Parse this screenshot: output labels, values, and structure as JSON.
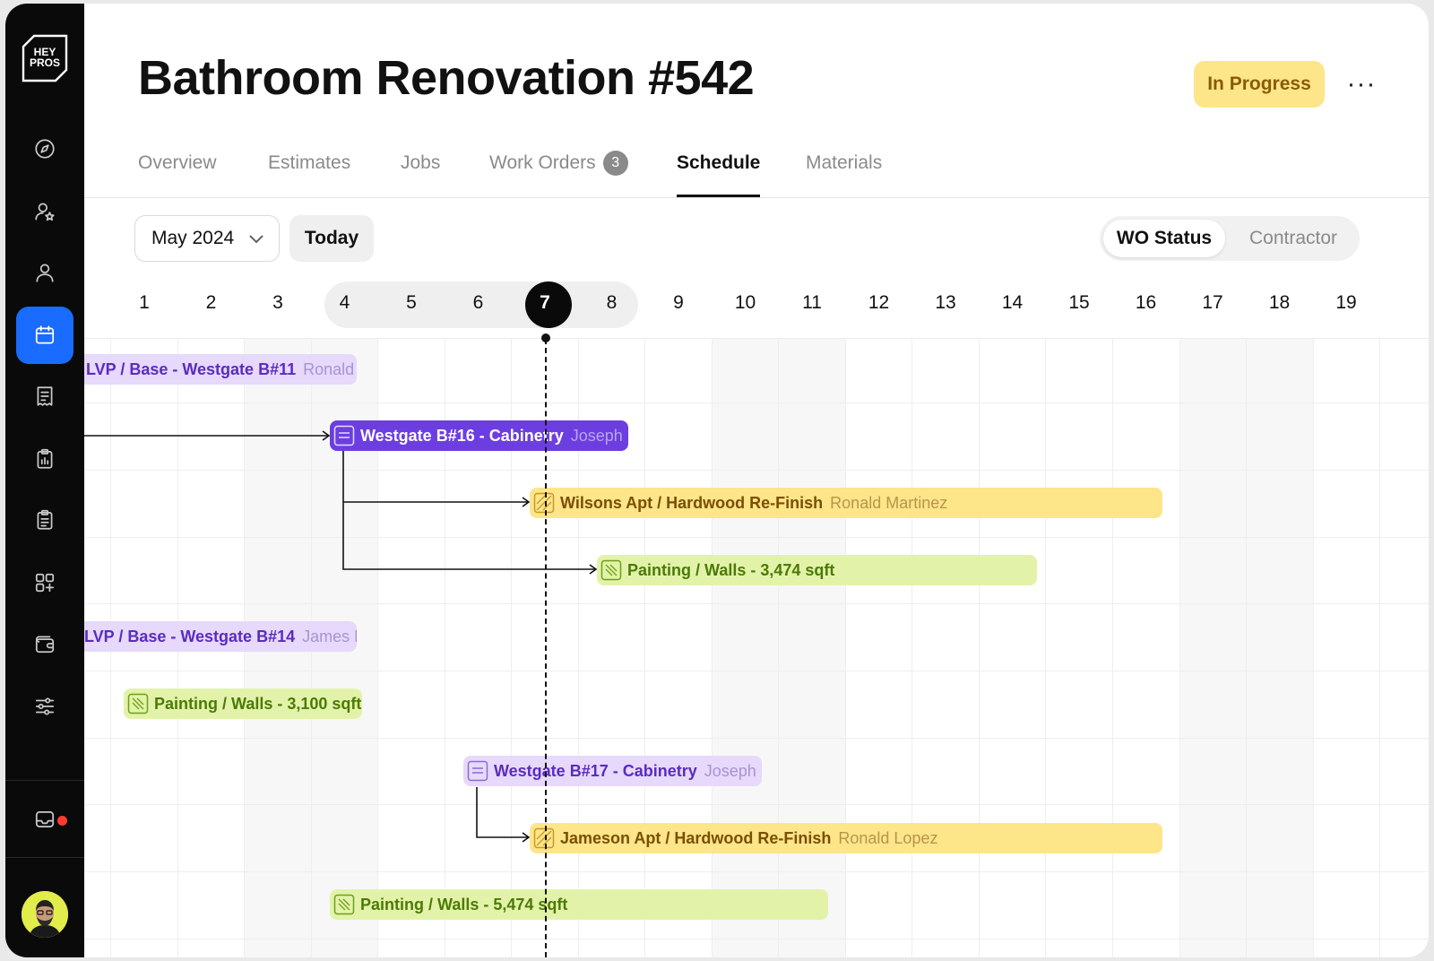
{
  "brand": {
    "logo_line1": "HEY",
    "logo_line2": "PROS"
  },
  "sidebar": {
    "items": [
      {
        "icon": "compass-icon",
        "active": false
      },
      {
        "icon": "user-star-icon",
        "active": false
      },
      {
        "icon": "user-icon",
        "active": false
      },
      {
        "icon": "calendar-icon",
        "active": true
      },
      {
        "icon": "receipt-icon",
        "active": false
      },
      {
        "icon": "clipboard-chart-icon",
        "active": false
      },
      {
        "icon": "clipboard-list-icon",
        "active": false
      },
      {
        "icon": "apps-add-icon",
        "active": false
      },
      {
        "icon": "wallet-icon",
        "active": false
      },
      {
        "icon": "sliders-icon",
        "active": false
      }
    ],
    "bottom": [
      {
        "icon": "inbox-icon",
        "has_notification": true
      },
      {
        "icon": "avatar"
      }
    ]
  },
  "header": {
    "title": "Bathroom Renovation #542",
    "status": "In Progress",
    "more": "···"
  },
  "tabs": [
    {
      "label": "Overview"
    },
    {
      "label": "Estimates"
    },
    {
      "label": "Jobs"
    },
    {
      "label": "Work Orders",
      "count": "3"
    },
    {
      "label": "Schedule",
      "active": true
    },
    {
      "label": "Materials"
    }
  ],
  "toolbar": {
    "month": "May 2024",
    "today": "Today",
    "view_toggle": {
      "active": "WO Status",
      "inactive": "Contractor"
    }
  },
  "schedule": {
    "days": [
      "1",
      "2",
      "3",
      "4",
      "5",
      "6",
      "7",
      "8",
      "9",
      "10",
      "11",
      "12",
      "13",
      "14",
      "15",
      "16",
      "17",
      "18",
      "19"
    ],
    "today": "7",
    "bars": [
      {
        "title": "LVP / Base - Westgate B#11",
        "who": "Ronald M",
        "style": "lavender",
        "icon": "none"
      },
      {
        "title": "Westgate B#16 - Cabinetry",
        "who": "Joseph R",
        "style": "violet",
        "icon": "cabinet-icon"
      },
      {
        "title": "Wilsons Apt / Hardwood Re-Finish",
        "who": "Ronald Martinez",
        "style": "amber",
        "icon": "hardwood-icon"
      },
      {
        "title": "Painting / Walls - 3,474 sqft",
        "who": "",
        "style": "lime",
        "icon": "paint-roller-icon"
      },
      {
        "title": "LVP / Base - Westgate B#14",
        "who": "James M",
        "style": "lavender",
        "icon": "none"
      },
      {
        "title": "Painting / Walls - 3,100 sqft",
        "who": "",
        "style": "lime",
        "icon": "paint-roller-icon"
      },
      {
        "title": "Westgate B#17 - Cabinetry",
        "who": "Joseph R",
        "style": "lavender",
        "icon": "cabinet-icon"
      },
      {
        "title": "Jameson Apt / Hardwood Re-Finish",
        "who": "Ronald Lopez",
        "style": "amber",
        "icon": "hardwood-icon"
      },
      {
        "title": "Painting / Walls - 5,474 sqft",
        "who": "",
        "style": "lime",
        "icon": "paint-roller-icon"
      }
    ]
  },
  "colors": {
    "accent": "#1a6bff",
    "status_bg": "#fde58a",
    "lavender": "#e6d9fb",
    "violet": "#6c3ee0",
    "amber": "#fde58a",
    "lime": "#e2f3a9"
  }
}
